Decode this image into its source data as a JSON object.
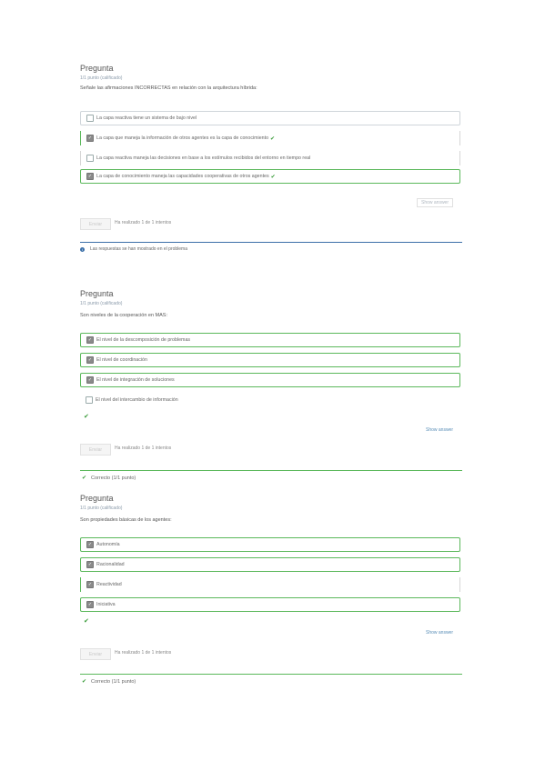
{
  "q1": {
    "title": "Pregunta",
    "points": "1/1 punto (calificado)",
    "prompt": "Señale las afirmaciones INCORRECTAS en relación con la arquitectura híbrida:",
    "options": [
      {
        "label": "La capa reactiva tiene un sistema de bajo nivel",
        "checked": false,
        "state": "plain",
        "tick": false
      },
      {
        "label": "La capa que maneja la información de otros agentes es la capa de conocimiento",
        "checked": true,
        "state": "flat",
        "tick": true
      },
      {
        "label": "La capa reactiva maneja las decisiones en base a los estímulos recibidos del entorno en tiempo real",
        "checked": false,
        "state": "plain",
        "tick": false
      },
      {
        "label": "La capa de conocimiento maneja las capacidades cooperativas de otros agentes",
        "checked": true,
        "state": "correct",
        "tick": true
      }
    ],
    "show_answer": "Show answer",
    "submit": "Enviar",
    "attempts": "Ha realizado 1 de 1 intentos",
    "notice": "Las respuestas se han mostrado en el problema",
    "notice_icon": "info-icon"
  },
  "q2": {
    "title": "Pregunta",
    "points": "1/1 punto (calificado)",
    "prompt": "Son niveles de la cooperación en MAS:",
    "options": [
      {
        "label": "El nivel de la descomposición de problemas",
        "checked": true,
        "state": "correct",
        "tick": false
      },
      {
        "label": "El nivel de coordinación",
        "checked": true,
        "state": "correct",
        "tick": false
      },
      {
        "label": "El nivel de integración de soluciones",
        "checked": true,
        "state": "correct",
        "tick": false
      },
      {
        "label": "El nivel del intercambio de información",
        "checked": false,
        "state": "plain",
        "tick": false
      }
    ],
    "show_answer": "Show answer",
    "submit": "Enviar",
    "attempts": "Ha realizado 1 de 1 intentos",
    "status": "Correcto (1/1 punto)"
  },
  "q3": {
    "title": "Pregunta",
    "points": "1/1 punto (calificado)",
    "prompt": "Son propiedades básicas de los agentes:",
    "options": [
      {
        "label": "Autonomía",
        "checked": true,
        "state": "correct",
        "tick": false
      },
      {
        "label": "Racionalidad",
        "checked": true,
        "state": "correct",
        "tick": false
      },
      {
        "label": "Reactividad",
        "checked": true,
        "state": "flat",
        "tick": false
      },
      {
        "label": "Iniciativa",
        "checked": true,
        "state": "correct",
        "tick": false
      }
    ],
    "show_answer": "Show answer",
    "submit": "Enviar",
    "attempts": "Ha realizado 1 de 1 intentos",
    "status": "Correcto (1/1 punto)"
  },
  "colors": {
    "correct": "#5bb85b",
    "link": "#5b8fb8",
    "info": "#3b6fa8"
  }
}
